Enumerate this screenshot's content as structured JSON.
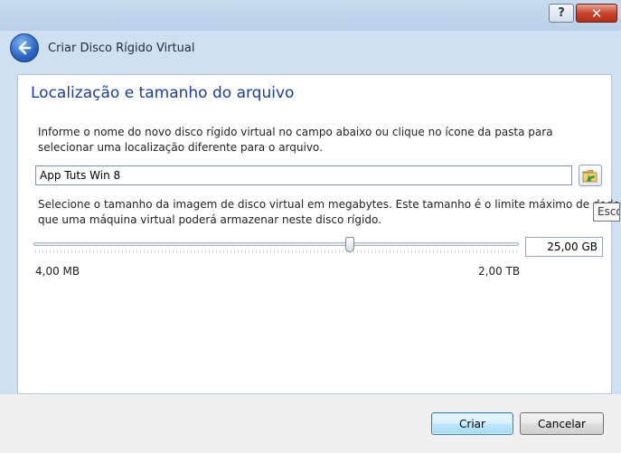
{
  "window": {
    "title": "Criar Disco Rígido Virtual",
    "help_glyph": "?",
    "close_glyph": "✕",
    "back_icon": "back-arrow-icon",
    "accent_color": "#1b3d9c"
  },
  "page": {
    "heading": "Localização e tamanho do arquivo",
    "location_description": "Informe o nome do novo disco rígido virtual no campo abaixo ou clique no ícone da pasta para selecionar uma localização diferente para o arquivo.",
    "file_name_value": "App Tuts Win 8",
    "folder_icon": "folder-icon",
    "tooltip_text": "Esco",
    "size_description_line1": "Selecione o tamanho da imagem de disco virtual em megabytes. Este tamanho é o limite máximo de dados",
    "size_description_line2": "que uma máquina virtual poderá armazenar neste disco rígido.",
    "size_value": "25,00 GB",
    "slider_fraction": 0.654,
    "min_label": "4,00 MB",
    "max_label": "2,00 TB"
  },
  "footer": {
    "create_label": "Criar",
    "cancel_label": "Cancelar"
  }
}
